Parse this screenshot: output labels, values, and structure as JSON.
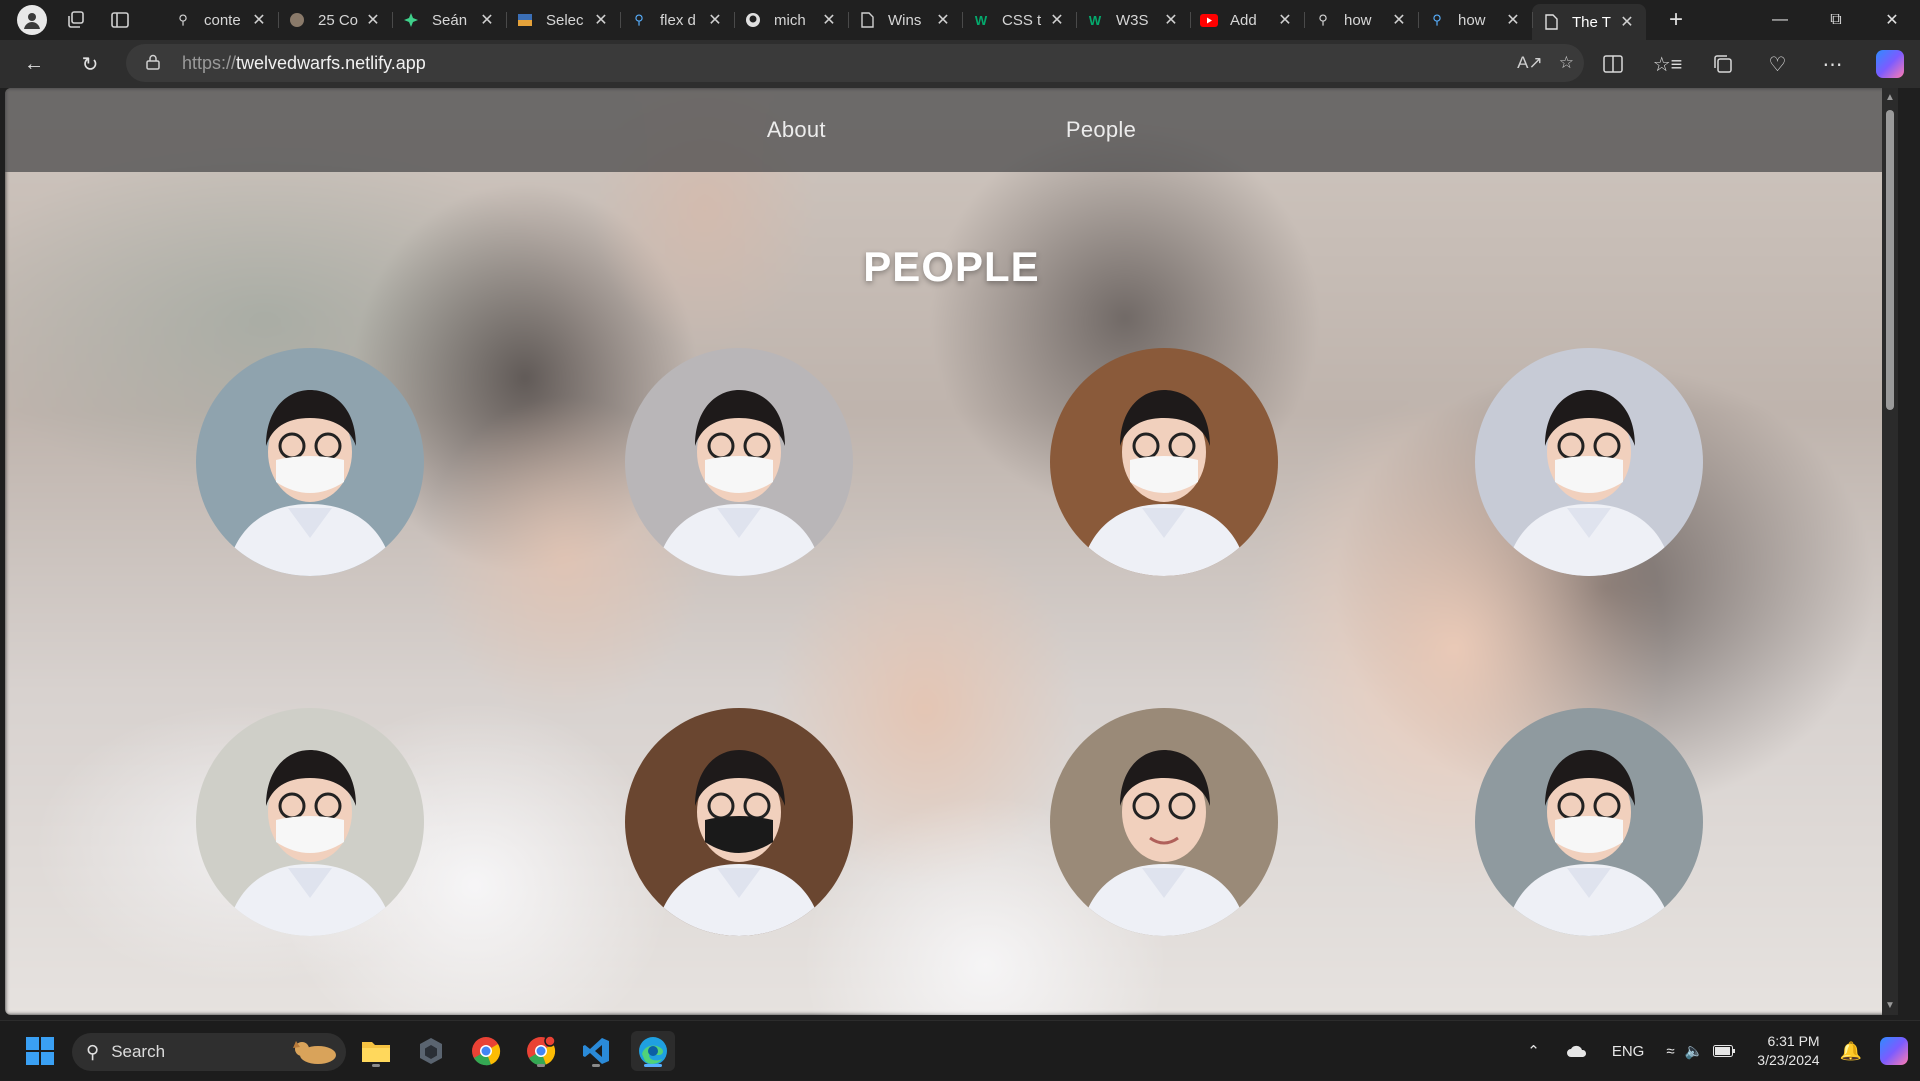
{
  "browser": {
    "tabs": [
      {
        "title": "conte",
        "icon": "search-icon"
      },
      {
        "title": "25 Co",
        "icon": "site-icon"
      },
      {
        "title": "Seán",
        "icon": "site-icon"
      },
      {
        "title": "Selec",
        "icon": "site-icon"
      },
      {
        "title": "flex d",
        "icon": "search-icon"
      },
      {
        "title": "mich",
        "icon": "github-icon"
      },
      {
        "title": "Wins",
        "icon": "page-icon"
      },
      {
        "title": "CSS t",
        "icon": "w3schools-icon"
      },
      {
        "title": "W3S",
        "icon": "w3schools-icon"
      },
      {
        "title": "Add",
        "icon": "youtube-icon"
      },
      {
        "title": "how",
        "icon": "search-icon"
      },
      {
        "title": "how",
        "icon": "search-icon"
      },
      {
        "title": "The T",
        "icon": "page-icon",
        "active": true
      }
    ],
    "url_scheme": "https://",
    "url_host": "twelvedwarfs.netlify.app"
  },
  "site": {
    "nav": {
      "about": "About",
      "people": "People"
    },
    "title": "PEOPLE",
    "people": [
      {
        "name": "person-1",
        "bg": "#8fa3ae"
      },
      {
        "name": "person-2",
        "bg": "#b9b6b8"
      },
      {
        "name": "person-3",
        "bg": "#8a5a3a"
      },
      {
        "name": "person-4",
        "bg": "#c7cbd6"
      },
      {
        "name": "person-5",
        "bg": "#cfcfc8"
      },
      {
        "name": "person-6",
        "bg": "#6a4630"
      },
      {
        "name": "person-7",
        "bg": "#9a8a78"
      },
      {
        "name": "person-8",
        "bg": "#8f9a9f"
      }
    ]
  },
  "taskbar": {
    "search_label": "Search",
    "tray": {
      "lang": "ENG",
      "time": "6:31 PM",
      "date": "3/23/2024"
    }
  },
  "colors": {
    "accent": "#58b0ff",
    "tab_bg": "#202020",
    "toolbar_bg": "#2e2e2e"
  }
}
